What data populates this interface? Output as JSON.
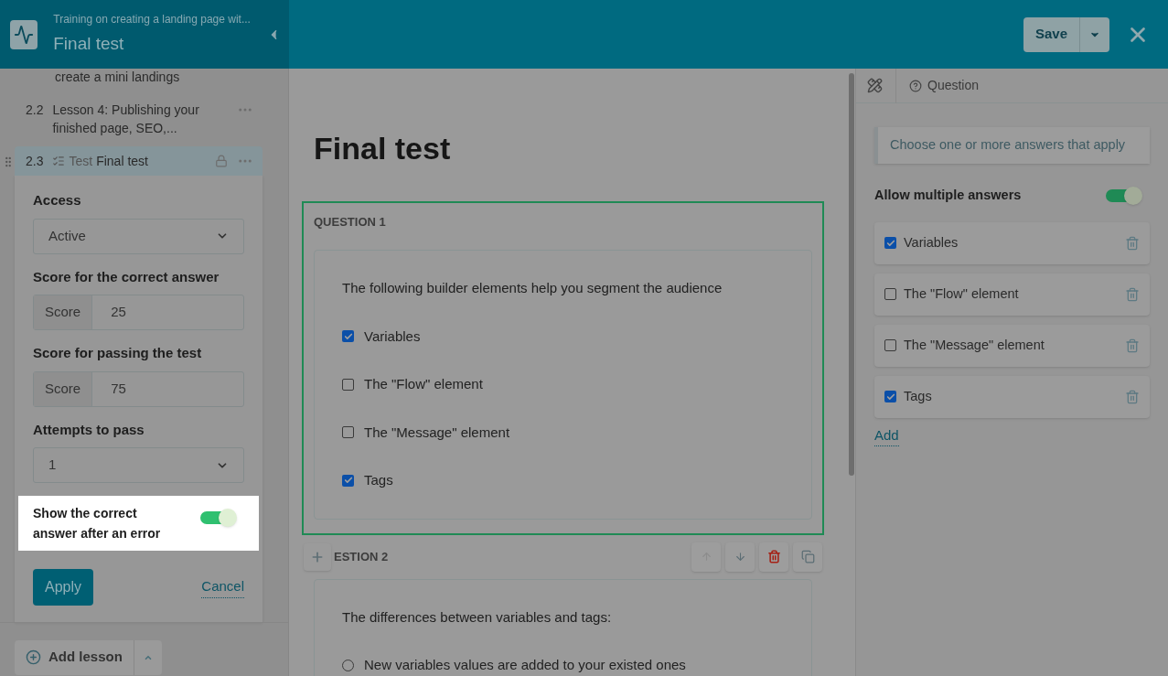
{
  "header": {
    "course": "Training on creating a landing page wit...",
    "title": "Final test",
    "save": "Save"
  },
  "sidebar": {
    "items": [
      {
        "kind": "fragment",
        "title": "create a mini landings"
      },
      {
        "kind": "lesson",
        "number": "2.2",
        "title": "Lesson 4: Publishing your finished page, SEO,...",
        "selected": false,
        "locked": false
      },
      {
        "kind": "test",
        "number": "2.3",
        "type_label": "Test",
        "title": "Final test",
        "selected": true,
        "locked": true
      }
    ],
    "settings": {
      "access": {
        "label": "Access",
        "value": "Active"
      },
      "score_correct": {
        "label": "Score for the correct answer",
        "prefix": "Score",
        "value": "25"
      },
      "score_pass": {
        "label": "Score for passing the test",
        "prefix": "Score",
        "value": "75"
      },
      "attempts": {
        "label": "Attempts to pass",
        "value": "1"
      },
      "show_correct": {
        "label": "Show the correct answer after an error",
        "on": true
      },
      "apply": "Apply",
      "cancel": "Cancel"
    },
    "add_lesson": "Add lesson"
  },
  "main": {
    "title": "Final test",
    "questions": [
      {
        "label": "QUESTION 1",
        "selected": true,
        "kind": "checkbox",
        "text": "The following builder elements help you segment the audience",
        "options": [
          {
            "label": "Variables",
            "checked": true
          },
          {
            "label": "The \"Flow\" element",
            "checked": false
          },
          {
            "label": "The \"Message\" element",
            "checked": false
          },
          {
            "label": "Tags",
            "checked": true
          }
        ]
      },
      {
        "label": "ESTION 2",
        "selected": false,
        "kind": "radio",
        "text": "The differences between variables and tags:",
        "options": [
          {
            "label": "New variables values are added to your existed ones",
            "checked": false
          }
        ]
      }
    ]
  },
  "panel": {
    "breadcrumb": "Question",
    "hint": "Choose one or more answers that apply",
    "allow_multiple": {
      "label": "Allow multiple answers",
      "on": true
    },
    "answers": [
      {
        "label": "Variables",
        "checked": true
      },
      {
        "label": "The \"Flow\" element",
        "checked": false
      },
      {
        "label": "The \"Message\" element",
        "checked": false
      },
      {
        "label": "Tags",
        "checked": true
      }
    ],
    "add": "Add"
  }
}
